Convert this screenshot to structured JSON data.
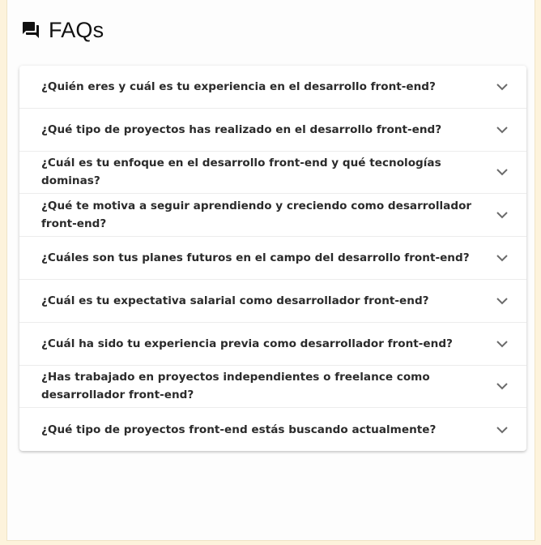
{
  "header": {
    "icon": "forum-icon",
    "title": "FAQs"
  },
  "faqs": [
    {
      "question": "¿Quién eres y cuál es tu experiencia en el desarrollo front-end?"
    },
    {
      "question": "¿Qué tipo de proyectos has realizado en el desarrollo front-end?"
    },
    {
      "question": "¿Cuál es tu enfoque en el desarrollo front-end y qué tecnologías dominas?"
    },
    {
      "question": "¿Qué te motiva a seguir aprendiendo y creciendo como desarrollador front-end?"
    },
    {
      "question": "¿Cuáles son tus planes futuros en el campo del desarrollo front-end?"
    },
    {
      "question": "¿Cuál es tu expectativa salarial como desarrollador front-end?"
    },
    {
      "question": "¿Cuál ha sido tu experiencia previa como desarrollador front-end?"
    },
    {
      "question": "¿Has trabajado en proyectos independientes o freelance como desarrollador front-end?"
    },
    {
      "question": "¿Qué tipo de proyectos front-end estás buscando actualmente?"
    }
  ],
  "colors": {
    "page_background": "#fdf3dc",
    "panel_background": "#fdfdfd",
    "text": "#2b2b2b",
    "chevron": "#6b6b6b"
  }
}
